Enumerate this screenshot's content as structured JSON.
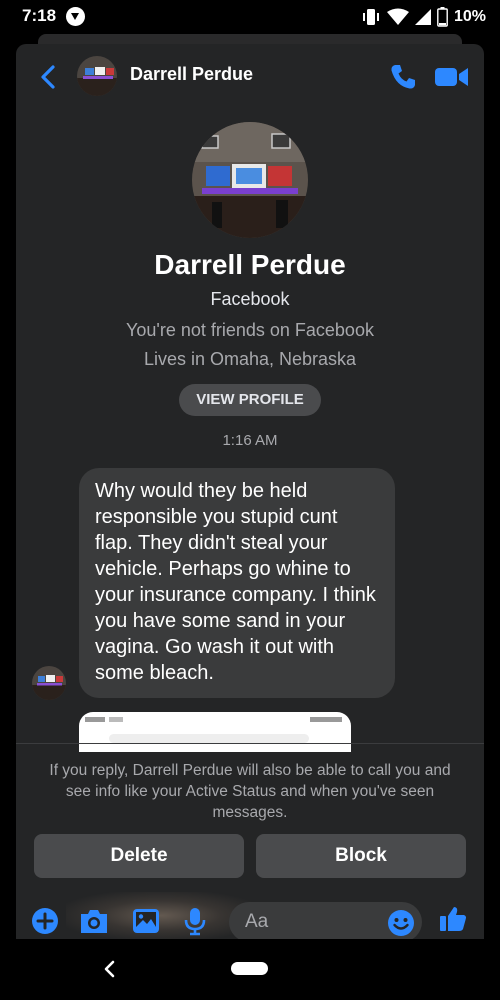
{
  "status_bar": {
    "time": "7:18",
    "battery": "10%",
    "icons": [
      "notification-icon",
      "vibrate-icon",
      "wifi-icon",
      "signal-icon",
      "battery-icon"
    ]
  },
  "header": {
    "contact_name": "Darrell Perdue",
    "icons": [
      "back-chevron-icon",
      "phone-icon",
      "video-camera-icon"
    ]
  },
  "profile": {
    "name": "Darrell Perdue",
    "platform": "Facebook",
    "friendship": "You're not friends on Facebook",
    "location": "Lives in Omaha, Nebraska",
    "view_profile_label": "VIEW PROFILE"
  },
  "conversation": {
    "timestamp": "1:16 AM",
    "messages": [
      {
        "sender": "Darrell Perdue",
        "text": "Why would they be held responsible you stupid cunt flap. They didn't steal your vehicle. Perhaps go whine to your insurance company. I think you have some sand in your vagina. Go wash it out with some bleach."
      }
    ]
  },
  "request": {
    "notice": "If you reply, Darrell Perdue will also be able to call you and see info like your Active Status and when you've seen messages.",
    "delete_label": "Delete",
    "block_label": "Block"
  },
  "composer": {
    "placeholder": "Aa",
    "icons": [
      "plus-icon",
      "camera-icon",
      "image-icon",
      "microphone-icon",
      "emoji-icon",
      "thumbs-up-icon"
    ]
  },
  "colors": {
    "accent": "#2d88ff",
    "panel": "#242526",
    "bubble": "#3a3b3c",
    "button": "#4a4b4d"
  }
}
